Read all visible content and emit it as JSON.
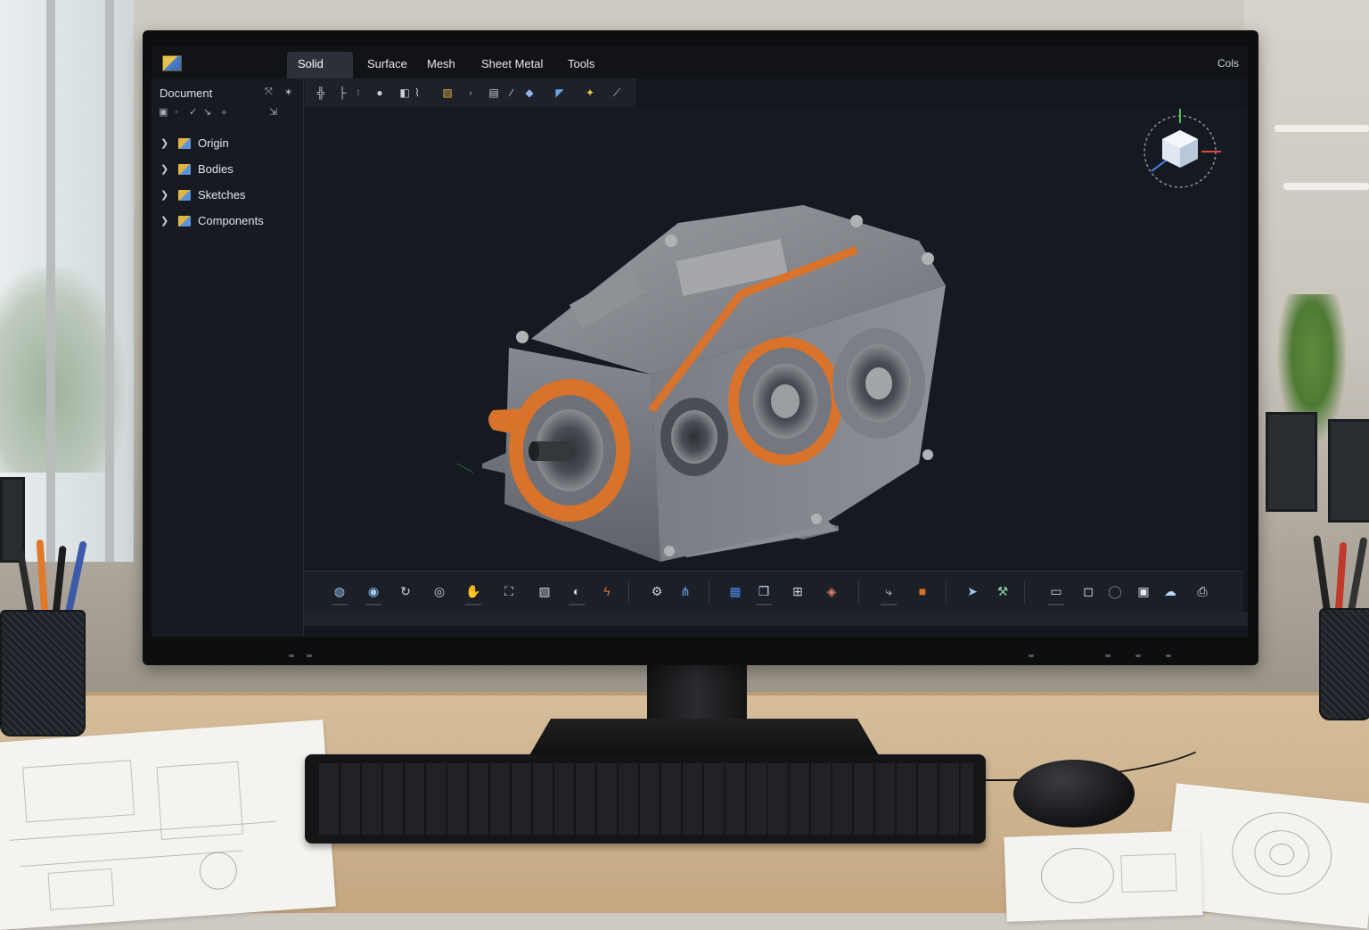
{
  "app": {
    "tabs": [
      {
        "label": "Solid",
        "active": true
      },
      {
        "label": "Surface",
        "active": false
      },
      {
        "label": "Mesh",
        "active": false
      },
      {
        "label": "Sheet Metal",
        "active": false
      },
      {
        "label": "Tools",
        "active": false
      }
    ],
    "top_right_label": "Cols"
  },
  "sidebar": {
    "title": "Document",
    "tree": [
      {
        "label": "Origin"
      },
      {
        "label": "Bodies"
      },
      {
        "label": "Sketches"
      },
      {
        "label": "Components"
      }
    ]
  },
  "viewport": {
    "model": "gearbox-housing",
    "accent_color": "#d9722a",
    "body_color": "#7f8289"
  },
  "toolbar_top_icons": [
    "sketch-grid-icon",
    "line-icon",
    "dot-icon",
    "sphere-icon",
    "extrude-icon",
    "image-icon",
    "arrow-icon",
    "list-icon",
    "pen-icon",
    "shape-icon",
    "shield-icon",
    "paint-icon",
    "wand-icon"
  ],
  "bottom_toolbar_icons": [
    "orbit-icon",
    "globe-icon",
    "rotate-icon",
    "camera-icon",
    "hand-icon",
    "fit-icon",
    "frame-icon",
    "sphere-view-icon",
    "measure-icon",
    "settings-icon",
    "nodes-icon",
    "save-icon",
    "layers-icon",
    "table-icon",
    "box-icon",
    "curve-icon",
    "material-icon",
    "arrow-icon",
    "wrench-icon",
    "display-icon",
    "square-icon",
    "circle-icon",
    "window-icon",
    "cloud-icon",
    "export-icon"
  ],
  "colors": {
    "screen_bg": "#14171d",
    "active_tab": "#2b3039",
    "accent_orange": "#d9722a",
    "axis_x": "#e0453f",
    "axis_y": "#4fbe5a",
    "axis_z": "#4a86e8"
  }
}
